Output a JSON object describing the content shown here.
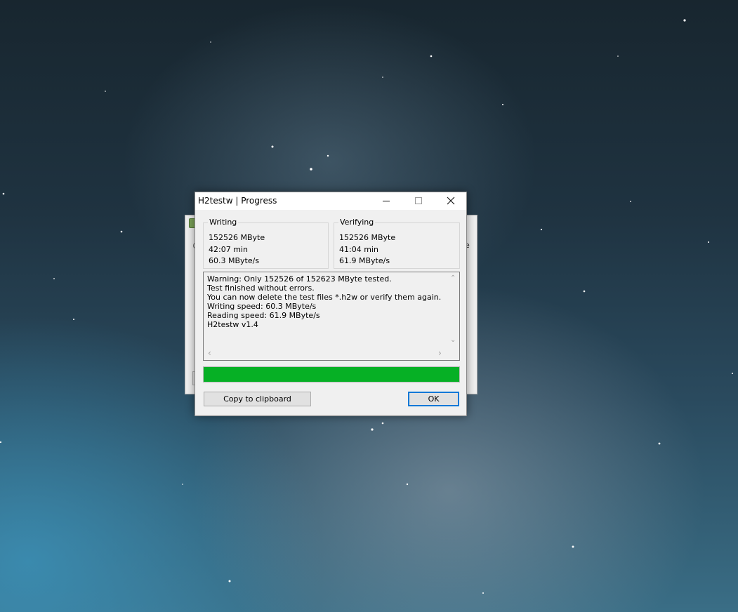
{
  "dialog": {
    "title": "H2testw | Progress",
    "writing": {
      "label": "Writing",
      "size": "152526 MByte",
      "time": "42:07 min",
      "speed": "60.3 MByte/s"
    },
    "verifying": {
      "label": "Verifying",
      "size": "152526 MByte",
      "time": "41:04 min",
      "speed": "61.9 MByte/s"
    },
    "log": [
      "Warning: Only 152526 of 152623 MByte tested.",
      "Test finished without errors.",
      "You can now delete the test files *.h2w or verify them again.",
      "Writing speed: 60.3 MByte/s",
      "Reading speed: 61.9 MByte/s",
      "H2testw v1.4"
    ],
    "progress": {
      "fraction": 1.0,
      "color": "#06b025"
    },
    "buttons": {
      "copy_label": "Copy to clipboard",
      "ok_label": "OK"
    }
  },
  "background_window": {
    "partial_glyph": "e"
  },
  "icons": {
    "minimize": "minimize-icon",
    "maximize": "maximize-icon",
    "close": "close-icon",
    "scroll_up": "scroll-up-arrow-icon",
    "scroll_down": "scroll-down-arrow-icon",
    "scroll_left": "scroll-left-arrow-icon",
    "scroll_right": "scroll-right-arrow-icon"
  },
  "colors": {
    "accent": "#0078d7",
    "progress": "#06b025",
    "dialog_bg": "#f0f0f0"
  }
}
